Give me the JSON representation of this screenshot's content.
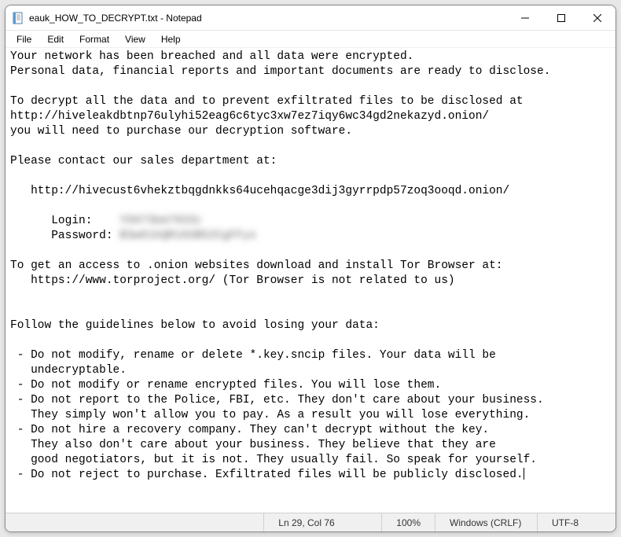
{
  "window": {
    "title": "eauk_HOW_TO_DECRYPT.txt - Notepad"
  },
  "menu": {
    "file": "File",
    "edit": "Edit",
    "format": "Format",
    "view": "View",
    "help": "Help"
  },
  "content": {
    "line1": "Your network has been breached and all data were encrypted.",
    "line2": "Personal data, financial reports and important documents are ready to disclose.",
    "line3": "",
    "line4": "To decrypt all the data and to prevent exfiltrated files to be disclosed at",
    "line5": "http://hiveleakdbtnp76ulyhi52eag6c6tyc3xw7ez7iqy6wc34gd2nekazyd.onion/",
    "line6": "you will need to purchase our decryption software.",
    "line7": "",
    "line8": "Please contact our sales department at:",
    "line9": "",
    "line10": "   http://hivecust6vhekztbqgdnkks64ucehqacge3dij3gyrrpdp57zoq3ooqd.onion/",
    "line11": "",
    "line12_label": "      Login:    ",
    "line12_value": "Y5073km7933c",
    "line13_label": "      Password: ",
    "line13_value": "B3w61kQR16UB52CgFFyx",
    "line14": "",
    "line15": "To get an access to .onion websites download and install Tor Browser at:",
    "line16": "   https://www.torproject.org/ (Tor Browser is not related to us)",
    "line17": "",
    "line18": "",
    "line19": "Follow the guidelines below to avoid losing your data:",
    "line20": "",
    "line21": " - Do not modify, rename or delete *.key.sncip files. Your data will be",
    "line22": "   undecryptable.",
    "line23": " - Do not modify or rename encrypted files. You will lose them.",
    "line24": " - Do not report to the Police, FBI, etc. They don't care about your business.",
    "line25": "   They simply won't allow you to pay. As a result you will lose everything.",
    "line26": " - Do not hire a recovery company. They can't decrypt without the key.",
    "line27": "   They also don't care about your business. They believe that they are",
    "line28": "   good negotiators, but it is not. They usually fail. So speak for yourself.",
    "line29": " - Do not reject to purchase. Exfiltrated files will be publicly disclosed."
  },
  "status": {
    "position": "Ln 29, Col 76",
    "zoom": "100%",
    "line_ending": "Windows (CRLF)",
    "encoding": "UTF-8"
  }
}
